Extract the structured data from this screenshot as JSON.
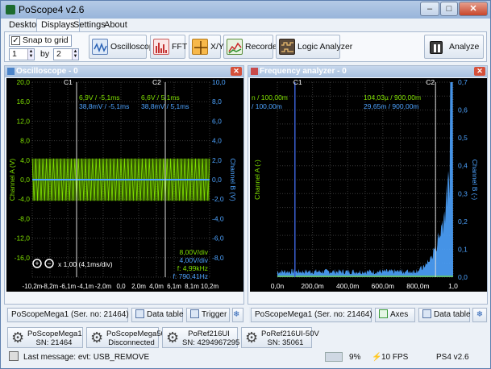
{
  "window": {
    "title": "PoScope4 v2.6",
    "min": "–",
    "max": "□",
    "close": "✕"
  },
  "menu": [
    {
      "label": "Desktop"
    },
    {
      "label": "Displays"
    },
    {
      "label": "Settings"
    },
    {
      "label": "About"
    }
  ],
  "toolbar": {
    "snap_label": "Snap to grid",
    "snap_check": "✓",
    "grid_x": "1",
    "by_label": "by",
    "grid_y": "2",
    "buttons": [
      {
        "label": "Oscilloscope"
      },
      {
        "label": "FFT"
      },
      {
        "label": "X/Y"
      },
      {
        "label": "Recorder"
      },
      {
        "label": "Logic Analyzer"
      }
    ],
    "analyze_label": "Analyze"
  },
  "osc": {
    "title": "Oscilloscope - 0",
    "close": "✕",
    "left_ticks": [
      "20,0",
      "16,0",
      "12,0",
      "8,0",
      "4,0",
      "0,0",
      "-4,0",
      "-8,0",
      "-12,0",
      "-16,0"
    ],
    "right_ticks": [
      "10,0",
      "8,0",
      "6,0",
      "4,0",
      "2,0",
      "0,0",
      "-2,0",
      "-4,0",
      "-6,0",
      "-8,0"
    ],
    "x_ticks": [
      "-10,2m",
      "-8,2m",
      "-6,1m",
      "-4,1m",
      "-2,0m",
      "0,0",
      "2,0m",
      "4,0m",
      "6,1m",
      "8,1m",
      "10,2m"
    ],
    "ylabel_left": "Channel A (V)",
    "ylabel_right": "Channel B (V)",
    "c1": "C1",
    "c2": "C2",
    "c1_a": "6,9V / -5,1ms",
    "c1_b": "38,8mV / -5,1ms",
    "c2_a": "6,6V / 5,1ms",
    "c2_b": "38,8mV / 5,1ms",
    "div_a": "8,00V/div",
    "div_b": "4,00V/div",
    "freq_a": "f: 4,99kHz",
    "freq_b": "f: 790,41Hz",
    "zoom_text": "x 1,00 (4,1ms/div)",
    "device_btn": "PoScopeMega1 (Ser. no: 21464)",
    "data_table": "Data table",
    "trigger": "Trigger"
  },
  "fft": {
    "title": "Frequency analyzer - 0",
    "close": "✕",
    "x_ticks": [
      "0,0n",
      "200,0m",
      "400,0m",
      "600,0m",
      "800,0m",
      "1,0"
    ],
    "right_ticks": [
      "0,7",
      "0,6",
      "0,5",
      "0,4",
      "0,3",
      "0,2",
      "0,1",
      "0,0"
    ],
    "ylabel_left": "Channel A (-)",
    "ylabel_right": "Channel B (-)",
    "c1": "C1",
    "c2": "C2",
    "c1_a": "n / 100,00m",
    "c1_b": "/ 100,00m",
    "c2_a": "104,03µ / 900,00m",
    "c2_b": "29,65m / 900,00m",
    "device_btn": "PoScopeMega1 (Ser. no: 21464)",
    "axes": "Axes",
    "data_table": "Data table"
  },
  "devices": [
    {
      "name": "PoScopeMega1",
      "sub": "SN: 21464"
    },
    {
      "name": "PoScopeMega50",
      "sub": "Disconnected"
    },
    {
      "name": "PoRef216UI",
      "sub": "SN: 4294967295"
    },
    {
      "name": "PoRef216UI-50V",
      "sub": "SN: 35061"
    }
  ],
  "status": {
    "message": "Last message: evt: USB_REMOVE",
    "cpu": "9%",
    "fps": "10 FPS",
    "version": "PS4 v2.6"
  },
  "colors": {
    "channel_a": "#7fe000",
    "channel_b": "#4da3ff",
    "cursor": "#3a5fd0"
  }
}
